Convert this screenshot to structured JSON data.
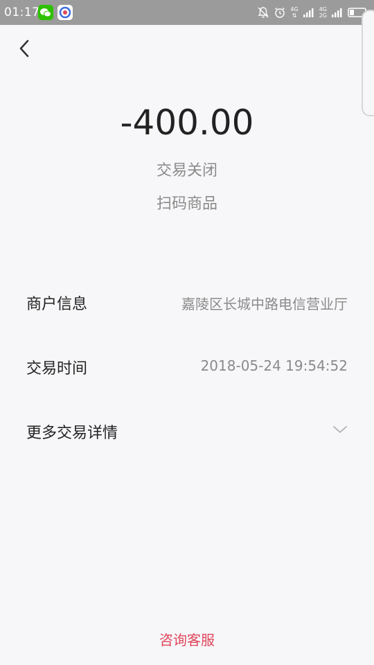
{
  "status_bar": {
    "time": "01:17",
    "network_top": "4G",
    "network_bottom": "2G"
  },
  "header": {
    "back_icon": "chevron-left-icon"
  },
  "transaction": {
    "amount": "-400.00",
    "status": "交易关闭",
    "product": "扫码商品"
  },
  "details": {
    "merchant_label": "商户信息",
    "merchant_value": "嘉陵区长城中路电信营业厅",
    "time_label": "交易时间",
    "time_value": "2018-05-24 19:54:52",
    "more_label": "更多交易详情"
  },
  "footer": {
    "service_label": "咨询客服"
  },
  "colors": {
    "accent": "#e0445a",
    "status_bar": "#9b9b9b",
    "background": "#f7f7f9"
  }
}
